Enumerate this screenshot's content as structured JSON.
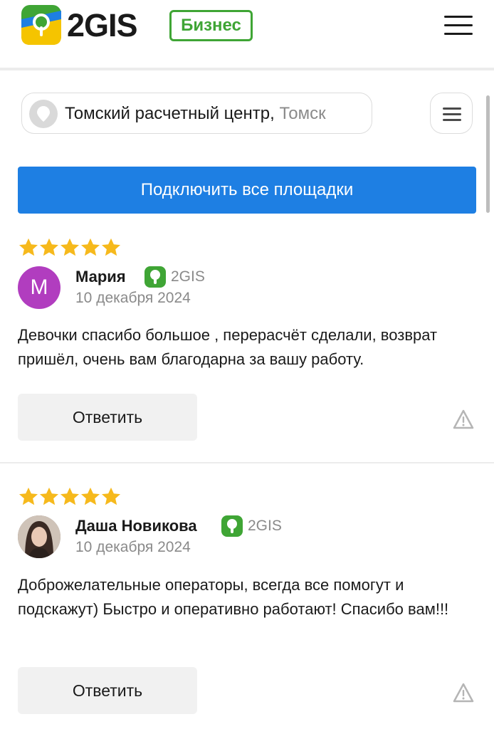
{
  "header": {
    "logo_text": "2GIS",
    "badge": "Бизнес"
  },
  "location": {
    "name": "Томский расчетный центр",
    "separator": ", ",
    "city": "Томск"
  },
  "connect_button": "Подключить все площадки",
  "colors": {
    "accent_blue": "#1e7fe3",
    "brand_green": "#3fa535",
    "star_yellow": "#f6b91c",
    "avatar_purple": "#b13dbf"
  },
  "reviews": [
    {
      "rating": 5,
      "avatar_letter": "М",
      "author": "Мария",
      "source": "2GIS",
      "date": "10 декабря 2024",
      "text": "Девочки спасибо большое , перерасчёт сделали, возврат пришёл, очень вам благодарна за вашу работу.",
      "reply_label": "Ответить"
    },
    {
      "rating": 5,
      "avatar_letter": "",
      "author": "Даша Новикова",
      "source": "2GIS",
      "date": "10 декабря 2024",
      "text": "Доброжелательные операторы, всегда все помогут и подскажут) Быстро и оперативно работают! Спасибо вам!!!",
      "reply_label": "Ответить"
    }
  ]
}
